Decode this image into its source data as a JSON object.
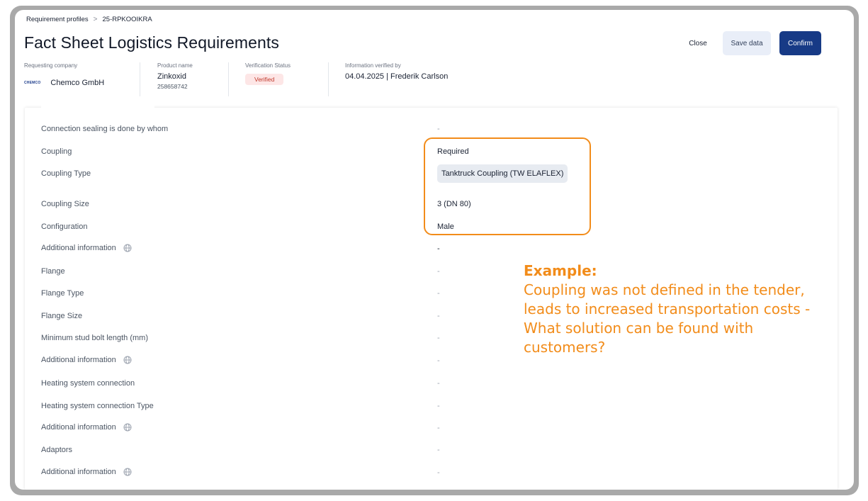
{
  "breadcrumb": {
    "root": "Requirement profiles",
    "separator": ">",
    "current": "25-RPKOOIKRA"
  },
  "page": {
    "title": "Fact Sheet Logistics Requirements"
  },
  "actions": {
    "close": "Close",
    "save": "Save data",
    "confirm": "Confirm"
  },
  "info": {
    "requesting_company_label": "Requesting company",
    "company_logo_text": "CHEMCO",
    "company_name": "Chemco GmbH",
    "product_name_label": "Product name",
    "product_name": "Zinkoxid",
    "product_number": "258658742",
    "verification_status_label": "Verification Status",
    "verification_status": "Verified",
    "verified_by_label": "Information verified by",
    "verified_by": "04.04.2025 | Frederik Carlson"
  },
  "rows": [
    {
      "label": "Connection sealing is done by whom",
      "value": "-"
    },
    {
      "label": "Coupling",
      "value": "Required"
    },
    {
      "label": "Coupling Type",
      "value": "Tanktruck Coupling (TW ELAFLEX)"
    },
    {
      "label": "Coupling Size",
      "value": "3 (DN 80)"
    },
    {
      "label": "Configuration",
      "value": "Male"
    },
    {
      "label": "Additional information",
      "value": "-"
    },
    {
      "label": "Flange",
      "value": "-"
    },
    {
      "label": "Flange Type",
      "value": "-"
    },
    {
      "label": "Flange Size",
      "value": "-"
    },
    {
      "label": "Minimum stud bolt length (mm)",
      "value": "-"
    },
    {
      "label": "Additional information",
      "value": "-"
    },
    {
      "label": "Heating system connection",
      "value": "-"
    },
    {
      "label": "Heating system connection Type",
      "value": "-"
    },
    {
      "label": "Additional information",
      "value": "-"
    },
    {
      "label": "Adaptors",
      "value": "-"
    },
    {
      "label": "Additional information",
      "value": "-"
    }
  ],
  "annotation": {
    "heading": "Example:",
    "body": "Coupling was not defined in the tender, leads to increased transportation costs - What solution can be found with customers?"
  },
  "colors": {
    "accent": "#f28c1a",
    "primary": "#173a86",
    "verified_badge_bg": "#fde6e6"
  },
  "icons": {
    "globe": "globe-icon",
    "breadcrumb_separator": "chevron-right-icon"
  }
}
